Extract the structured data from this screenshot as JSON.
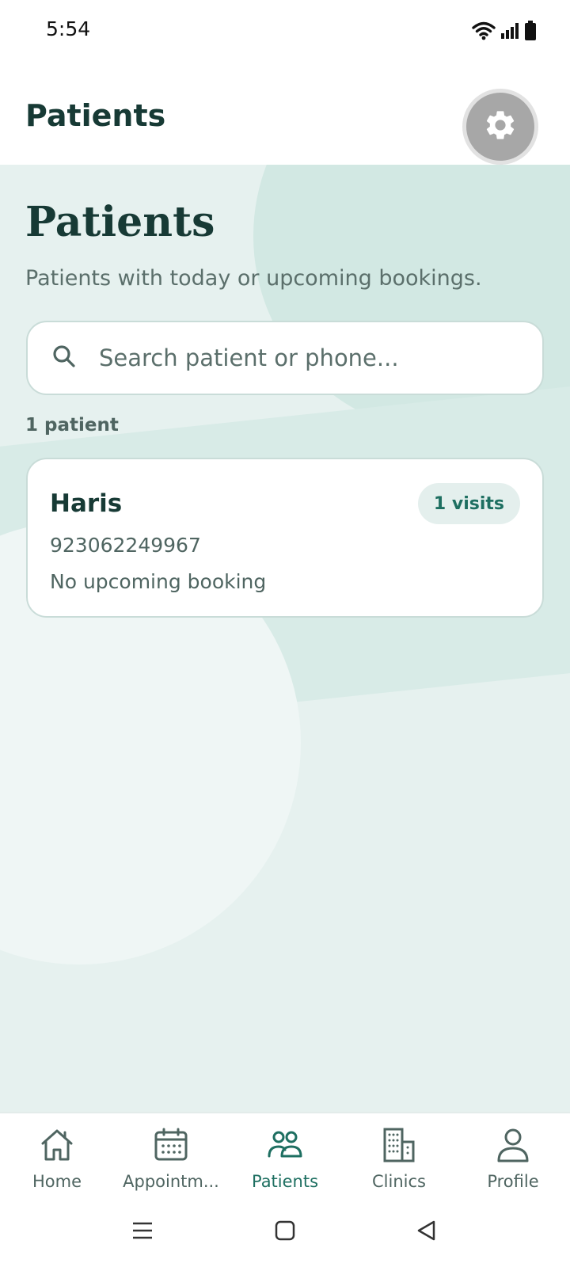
{
  "status_bar": {
    "time": "5:54"
  },
  "app_bar": {
    "title": "Patients"
  },
  "page": {
    "heading": "Patients",
    "subtitle": "Patients with today or upcoming bookings."
  },
  "search": {
    "placeholder": "Search patient or phone..."
  },
  "patient_count": "1 patient",
  "patients": [
    {
      "name": "Haris",
      "visits": "1 visits",
      "phone": "923062249967",
      "booking": "No upcoming booking"
    }
  ],
  "bottom_nav": {
    "items": [
      {
        "label": "Home",
        "icon": "home-icon"
      },
      {
        "label": "Appointm...",
        "icon": "calendar-icon"
      },
      {
        "label": "Patients",
        "icon": "users-icon",
        "active": true
      },
      {
        "label": "Clinics",
        "icon": "building-icon"
      },
      {
        "label": "Profile",
        "icon": "user-icon"
      }
    ]
  },
  "colors": {
    "primary": "#173a35",
    "accent": "#1e6f61",
    "background": "#e6f1ef",
    "muted_text": "#5b6f6b"
  }
}
